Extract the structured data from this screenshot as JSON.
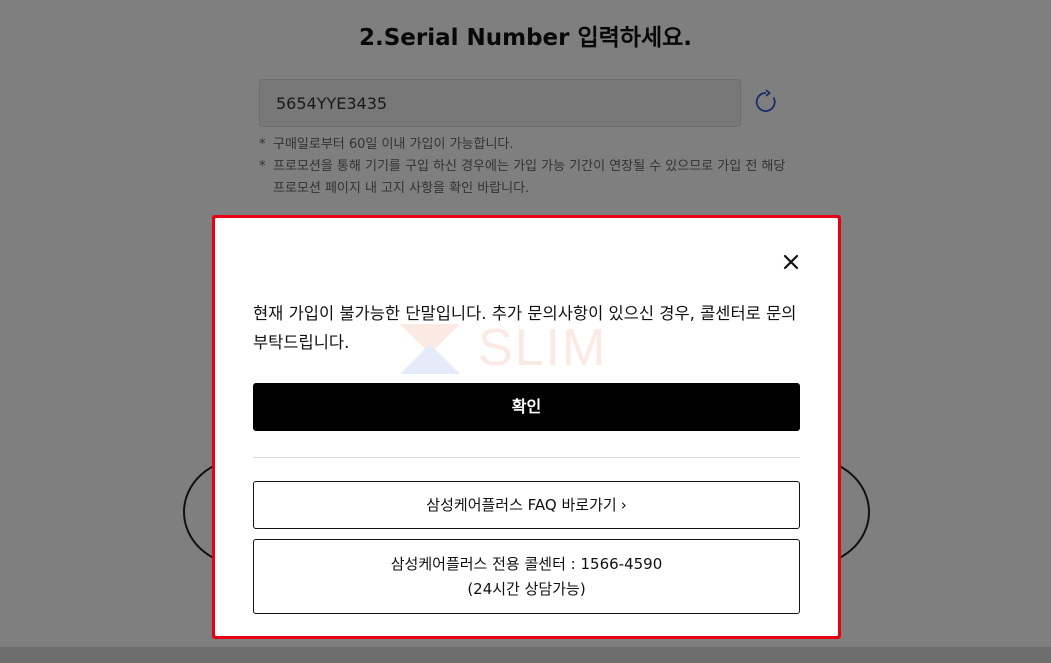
{
  "page": {
    "title": "2.Serial Number 입력하세요.",
    "serial_value": "5654YYE3435",
    "notes": [
      "구매일로부터 60일 이내 가입이 가능합니다.",
      "프로모션을 통해 기기를 구입 하신 경우에는 가입 가능 기간이 연장될 수 있으므로 가입 전 해당 프로모션 페이지 내 고지 사항을 확인 바랍니다."
    ]
  },
  "modal": {
    "message": "현재 가입이 불가능한 단말입니다. 추가 문의사항이 있으신 경우, 콜센터로 문의 부탁드립니다.",
    "confirm_label": "확인",
    "faq_label": "삼성케어플러스 FAQ 바로가기",
    "faq_chevron": "›",
    "call_line1": "삼성케어플러스 전용 콜센터 : 1566-4590",
    "call_line2": "(24시간 상담가능)",
    "close_icon": "close-icon",
    "watermark_text": "SLIM"
  },
  "colors": {
    "highlight": "#e60012",
    "refresh": "#2f5fd0",
    "confirm_bg": "#000000"
  }
}
